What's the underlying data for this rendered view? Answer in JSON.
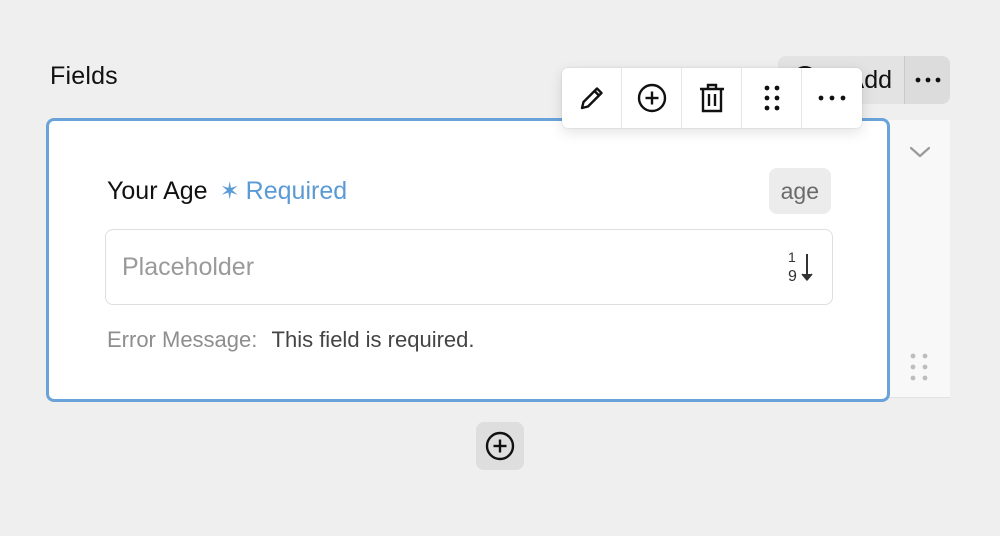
{
  "section": {
    "title": "Fields"
  },
  "header_actions": {
    "add_label": "Add",
    "add_icon": "plus-circle-icon",
    "more_icon": "more-horizontal-icon"
  },
  "toolbar": {
    "buttons": [
      {
        "icon": "pencil-icon"
      },
      {
        "icon": "plus-circle-icon"
      },
      {
        "icon": "trash-icon"
      },
      {
        "icon": "drag-handle-icon"
      },
      {
        "icon": "more-horizontal-icon"
      }
    ]
  },
  "field": {
    "label": "Your Age",
    "required_marker": "✶",
    "required_text": "Required",
    "key": "age",
    "placeholder": "Placeholder",
    "input_icon": "sort-numeric-icon",
    "error_label": "Error Message:",
    "error_message": "This field is required."
  },
  "side": {
    "chevron_icon": "chevron-down-icon",
    "drag_icon": "drag-handle-icon"
  },
  "colors": {
    "accent": "#5b9bd5",
    "card_border": "#6aa3d9",
    "background": "#efefef"
  }
}
